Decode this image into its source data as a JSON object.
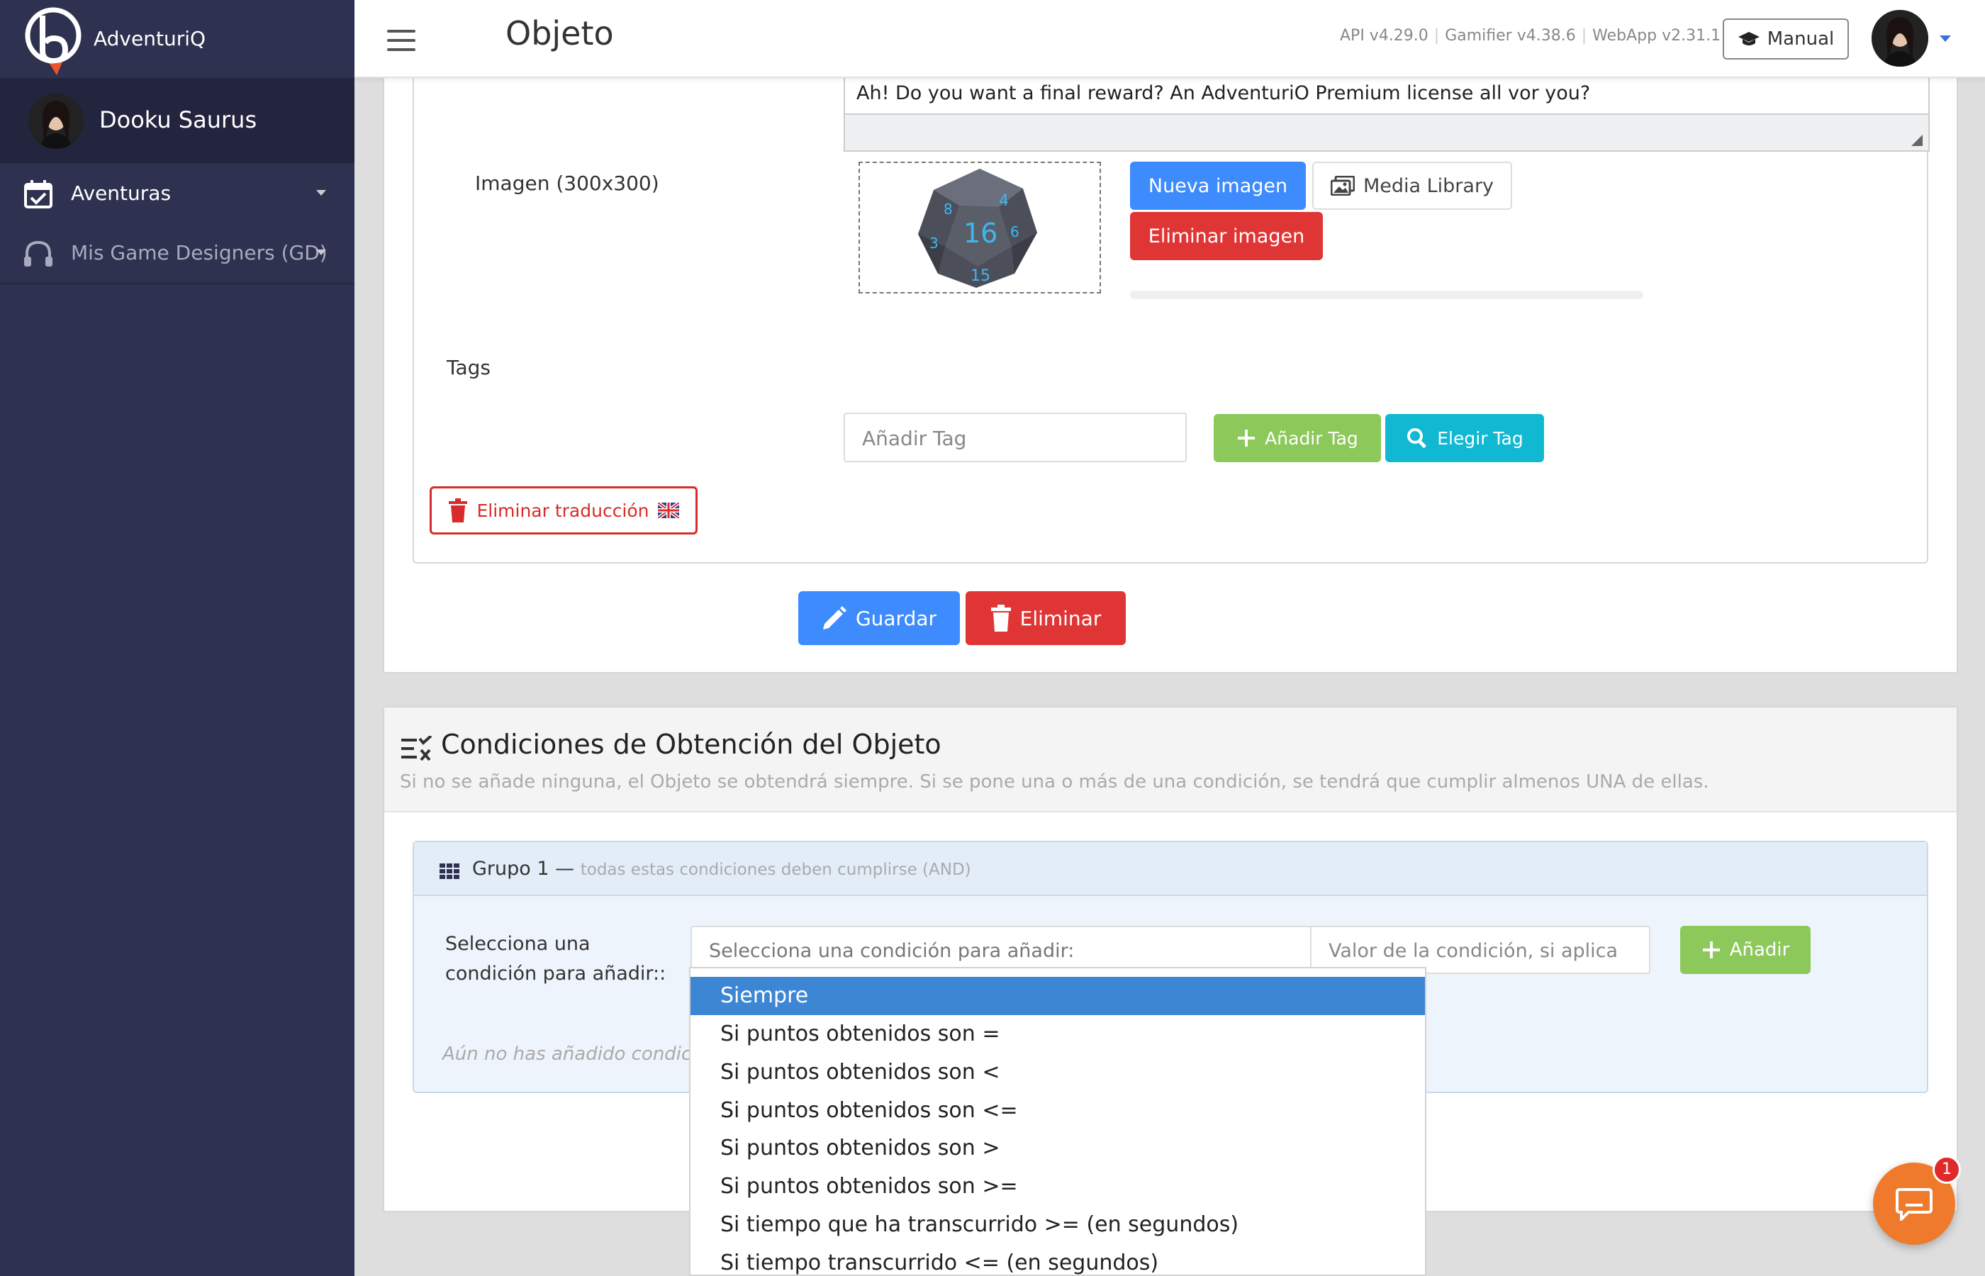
{
  "app": {
    "brand": "AdventuriQ"
  },
  "sidebar": {
    "user_name": "Dooku Saurus",
    "items": [
      {
        "label": "Aventuras",
        "icon": "calendar-check-icon"
      },
      {
        "label": "Mis Game Designers (GD)",
        "icon": "headphones-icon"
      }
    ]
  },
  "topbar": {
    "title": "Objeto",
    "versions": [
      "API v4.29.0",
      "Gamifier v4.38.6",
      "WebApp v2.31.1"
    ],
    "manual_label": "Manual"
  },
  "object_form": {
    "textarea_value": "Ah! Do you want a final reward? An AdventuriO Premium license all vor you?",
    "image_label": "Imagen (300x300)",
    "new_image_label": "Nueva imagen",
    "media_library_label": "Media Library",
    "delete_image_label": "Eliminar imagen",
    "upload_progress": 0,
    "tags_label": "Tags",
    "tag_placeholder": "Añadir Tag",
    "add_tag_label": "Añadir Tag",
    "choose_tag_label": "Elegir Tag",
    "delete_translation_label": "Eliminar traducción",
    "save_label": "Guardar",
    "delete_label": "Eliminar"
  },
  "conditions": {
    "title": "Condiciones de Obtención del Objeto",
    "subtitle": "Si no se añade ninguna, el Objeto se obtendrá siempre. Si se pone una o más de una condición, se tendrá que cumplir almenos UNA de ellas.",
    "group_title": "Grupo 1 —",
    "group_note": "todas estas condiciones deben cumplirse (AND)",
    "select_label_line1": "Selecciona una",
    "select_label_line2": "condición para añadir::",
    "select_placeholder": "Selecciona una condición para añadir:",
    "value_placeholder": "Valor de la condición, si aplica",
    "add_label": "Añadir",
    "empty_note": "Aún no has añadido condiciones"
  },
  "dropdown": {
    "options": [
      "Siempre",
      "Si puntos obtenidos son =",
      "Si puntos obtenidos son <",
      "Si puntos obtenidos son <=",
      "Si puntos obtenidos son >",
      "Si puntos obtenidos son >=",
      "Si tiempo que ha transcurrido >= (en segundos)",
      "Si tiempo transcurrido <= (en segundos)"
    ],
    "selected": "Siempre"
  },
  "chat": {
    "badge_count": "1"
  },
  "colors": {
    "sidebar_bg": "#2e3150",
    "primary": "#3d8bfd",
    "danger": "#e03535",
    "success": "#8cc85a",
    "info": "#10b8d2",
    "chat": "#f07a2b"
  }
}
